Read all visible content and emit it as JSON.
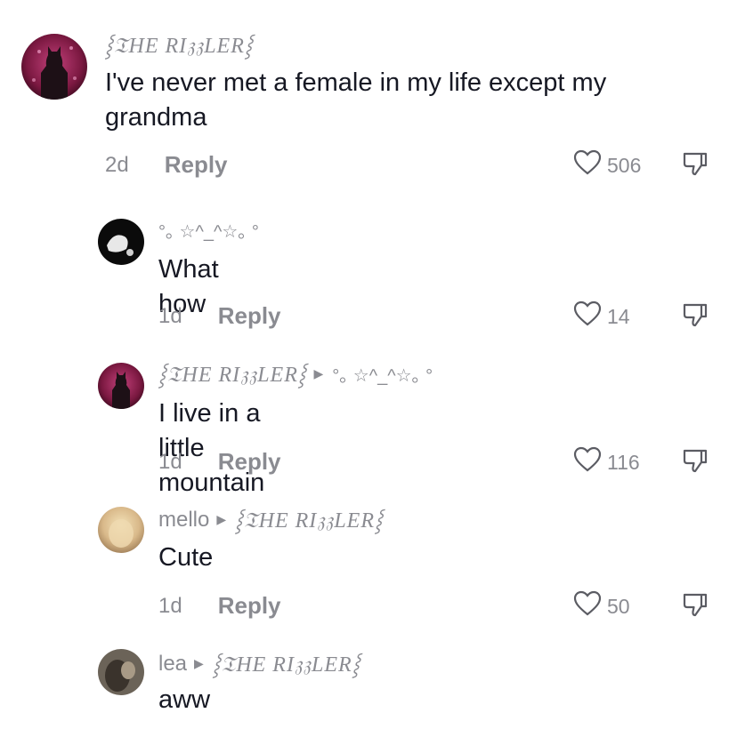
{
  "comments": [
    {
      "user": "⸾𝔗HE RI𝔷𝔷LER⸾",
      "reply_to": "",
      "text": "I've never met a female in my life except my grandma",
      "time": "2d",
      "reply_label": "Reply",
      "likes": "506"
    },
    {
      "user": "°｡ ☆^_^☆｡ °",
      "reply_to": "",
      "text": "What how",
      "time": "1d",
      "reply_label": "Reply",
      "likes": "14"
    },
    {
      "user": "⸾𝔗HE RI𝔷𝔷LER⸾",
      "reply_to": "°｡ ☆^_^☆｡ °",
      "text": "I live in a little mountain",
      "time": "1d",
      "reply_label": "Reply",
      "likes": "116"
    },
    {
      "user": "mello",
      "reply_to": "⸾𝔗HE RI𝔷𝔷LER⸾",
      "text": "Cute",
      "time": "1d",
      "reply_label": "Reply",
      "likes": "50"
    },
    {
      "user": "lea",
      "reply_to": "⸾𝔗HE RI𝔷𝔷LER⸾",
      "text": "aww",
      "time": "",
      "reply_label": "",
      "likes": ""
    }
  ],
  "icons": {
    "like": "heart-outline-icon",
    "dislike": "thumbs-down-icon",
    "reply_arrow": "triangle-right-icon"
  },
  "colors": {
    "text_primary": "#161823",
    "text_secondary": "#8a8b91"
  }
}
